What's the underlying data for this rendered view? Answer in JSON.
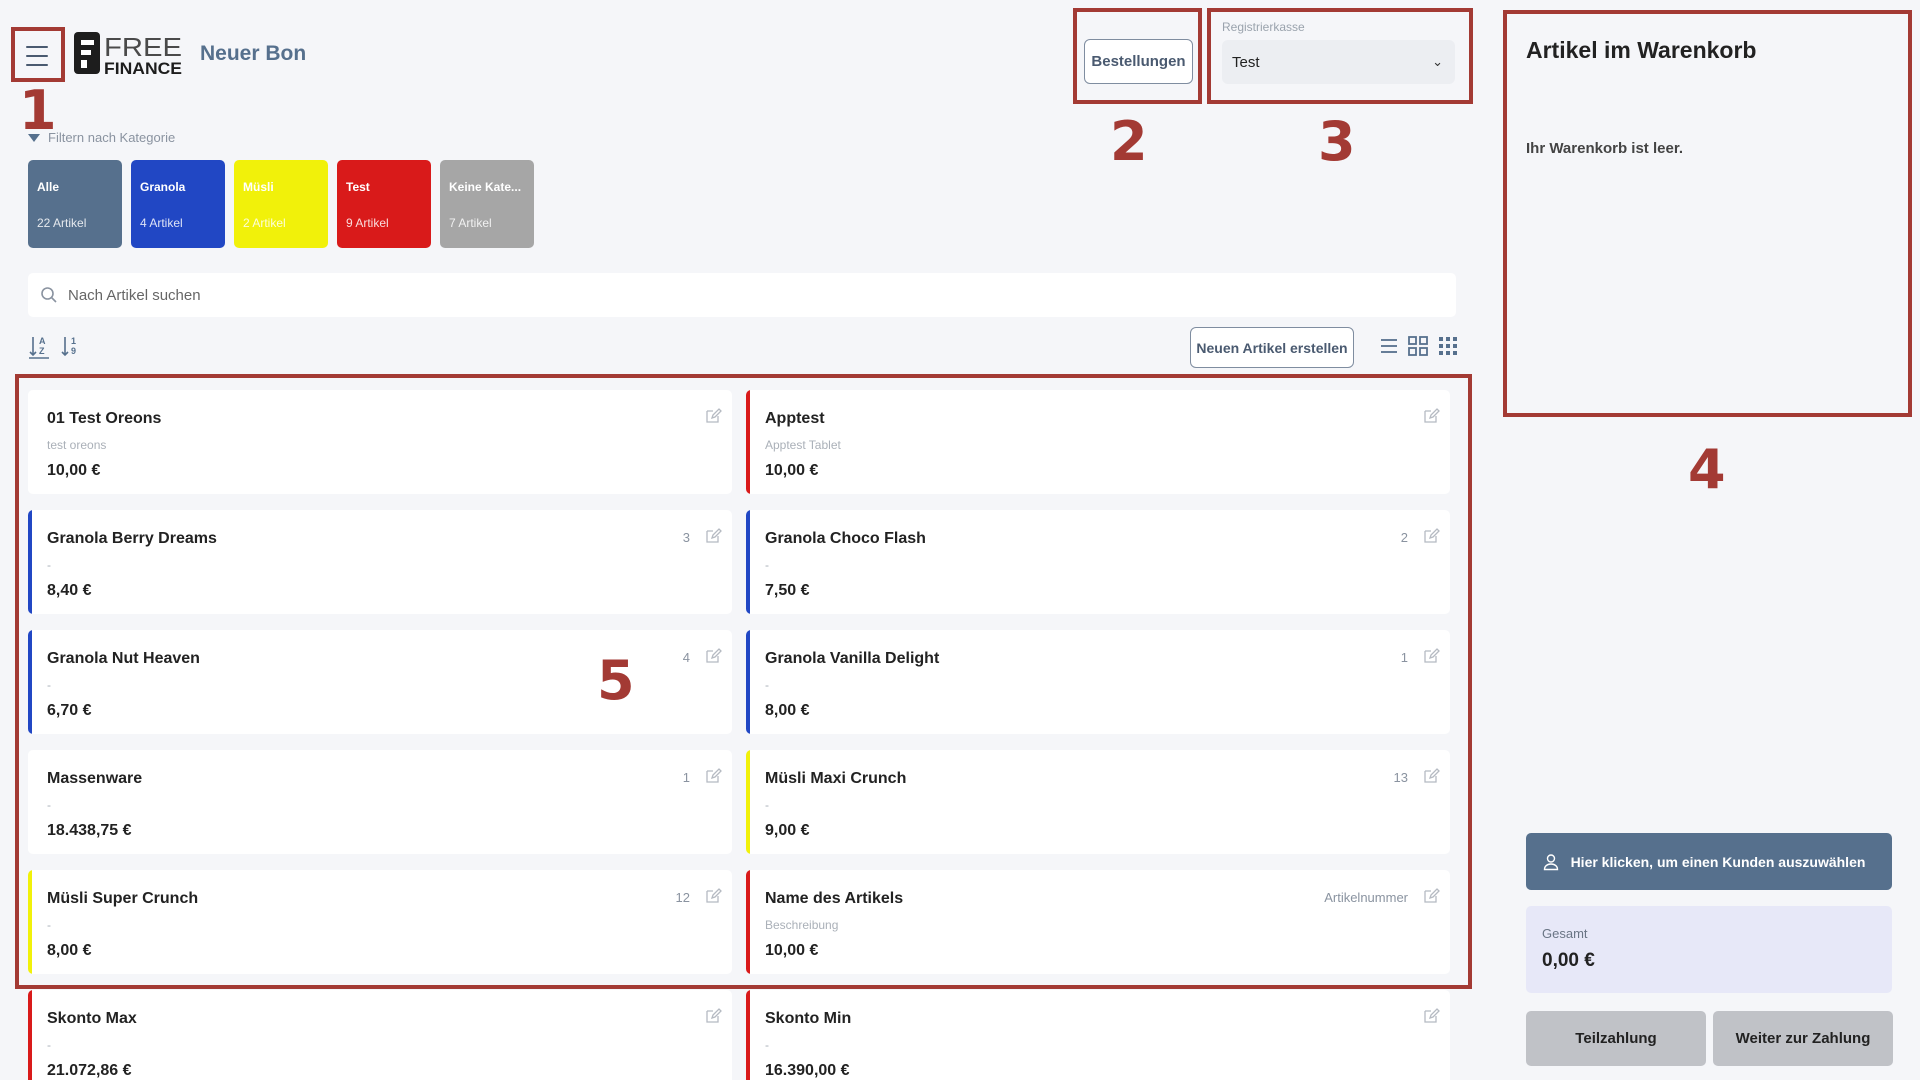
{
  "header": {
    "title": "Neuer Bon",
    "logo_text_top": "FREE",
    "logo_text_bottom": "FINANCE",
    "orders_label": "Bestellungen",
    "register_label": "Registrierkasse",
    "register_value": "Test"
  },
  "filter": {
    "toggle_label": "Filtern nach Kategorie",
    "categories": [
      {
        "name": "Alle",
        "count": "22 Artikel",
        "color": "#56708d"
      },
      {
        "name": "Granola",
        "count": "4 Artikel",
        "color": "#2147c4"
      },
      {
        "name": "Müsli",
        "count": "2 Artikel",
        "color": "#f1f10a"
      },
      {
        "name": "Test",
        "count": "9 Artikel",
        "color": "#d91a1a"
      },
      {
        "name": "Keine Kate...",
        "count": "7 Artikel",
        "color": "#a6a6a6"
      }
    ]
  },
  "search": {
    "placeholder": "Nach Artikel suchen"
  },
  "toolbar": {
    "new_article_label": "Neuen Artikel erstellen"
  },
  "icons": {
    "menu": "hamburger-icon",
    "search": "search-icon",
    "sort_alpha": "sort-alpha-icon",
    "sort_num": "sort-numeric-icon",
    "edit": "edit-icon",
    "list_view": "list-view-icon",
    "grid_view": "grid-view-icon",
    "compact_grid_view": "compact-grid-view-icon",
    "user": "user-icon"
  },
  "articles": [
    {
      "name": "01 Test Oreons",
      "desc": "test oreons",
      "price": "10,00 €",
      "number": "",
      "color": "#ffffff"
    },
    {
      "name": "Apptest",
      "desc": "Apptest Tablet",
      "price": "10,00 €",
      "number": "",
      "color": "#d91a1a"
    },
    {
      "name": "Granola Berry Dreams",
      "desc": "-",
      "price": "8,40 €",
      "number": "3",
      "color": "#2147c4"
    },
    {
      "name": "Granola Choco Flash",
      "desc": "-",
      "price": "7,50 €",
      "number": "2",
      "color": "#2147c4"
    },
    {
      "name": "Granola Nut Heaven",
      "desc": "-",
      "price": "6,70 €",
      "number": "4",
      "color": "#2147c4"
    },
    {
      "name": "Granola Vanilla Delight",
      "desc": "-",
      "price": "8,00 €",
      "number": "1",
      "color": "#2147c4"
    },
    {
      "name": "Massenware",
      "desc": "-",
      "price": "18.438,75 €",
      "number": "1",
      "color": "#ffffff"
    },
    {
      "name": "Müsli Maxi Crunch",
      "desc": "-",
      "price": "9,00 €",
      "number": "13",
      "color": "#f1f10a"
    },
    {
      "name": "Müsli Super Crunch",
      "desc": "-",
      "price": "8,00 €",
      "number": "12",
      "color": "#f1f10a"
    },
    {
      "name": "Name des Artikels",
      "desc": "Beschreibung",
      "price": "10,00 €",
      "number": "Artikelnummer",
      "color": "#d91a1a"
    },
    {
      "name": "Skonto Max",
      "desc": "-",
      "price": "21.072,86 €",
      "number": "",
      "color": "#d91a1a"
    },
    {
      "name": "Skonto Min",
      "desc": "-",
      "price": "16.390,00 €",
      "number": "",
      "color": "#d91a1a"
    }
  ],
  "cart": {
    "title": "Artikel im Warenkorb",
    "empty_text": "Ihr Warenkorb ist leer.",
    "customer_label": "Hier klicken, um einen Kunden auszuwählen",
    "total_label": "Gesamt",
    "total_value": "0,00 €",
    "partial_payment_label": "Teilzahlung",
    "checkout_label": "Weiter zur Zahlung"
  },
  "annotations": [
    "1",
    "2",
    "3",
    "4",
    "5"
  ],
  "colors": {
    "accent": "#56708d",
    "annotation": "#a33a34"
  }
}
